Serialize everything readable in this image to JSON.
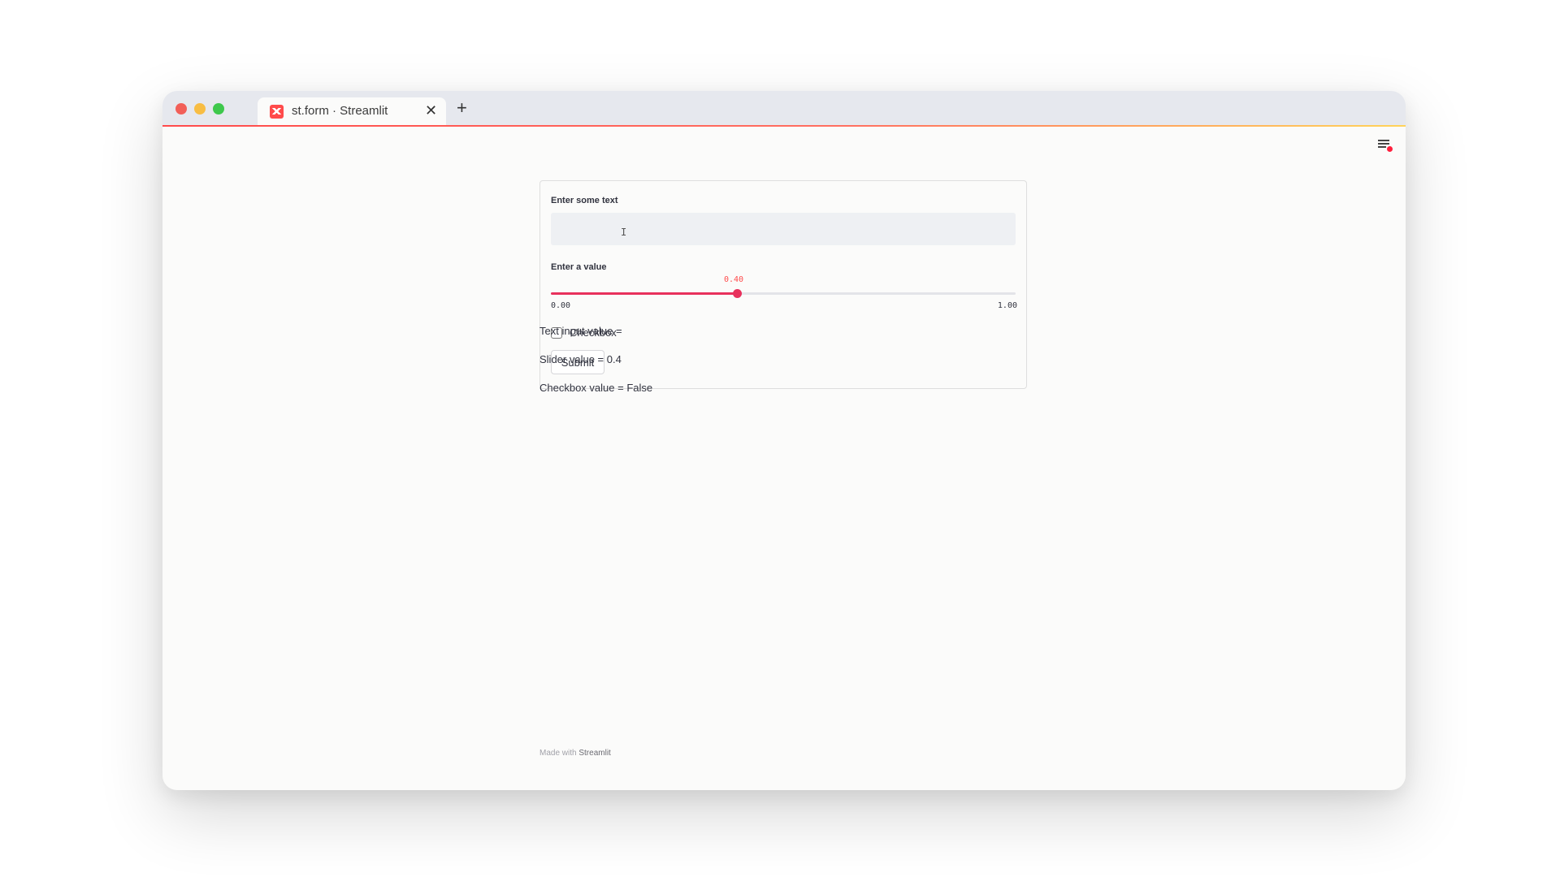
{
  "browser": {
    "tab_title": "st.form · Streamlit",
    "tab_icon": "streamlit-favicon-icon",
    "close_glyph": "✕",
    "new_tab_glyph": "+"
  },
  "colors": {
    "accent": "#ff4b4b",
    "slider": "#e8315c",
    "text": "#31333f"
  },
  "form": {
    "text_label": "Enter some text",
    "text_value": "",
    "slider_label": "Enter a value",
    "slider_value": 0.4,
    "slider_value_display": "0.40",
    "slider_min": "0.00",
    "slider_max": "1.00",
    "checkbox_label": "Checkbox",
    "checkbox_checked": false,
    "submit_label": "Submit"
  },
  "output": {
    "text_line": "Text input value =",
    "slider_line": "Slider value = 0.4",
    "checkbox_line": "Checkbox value = False"
  },
  "footer": {
    "made_with": "Made with",
    "brand": "Streamlit"
  }
}
